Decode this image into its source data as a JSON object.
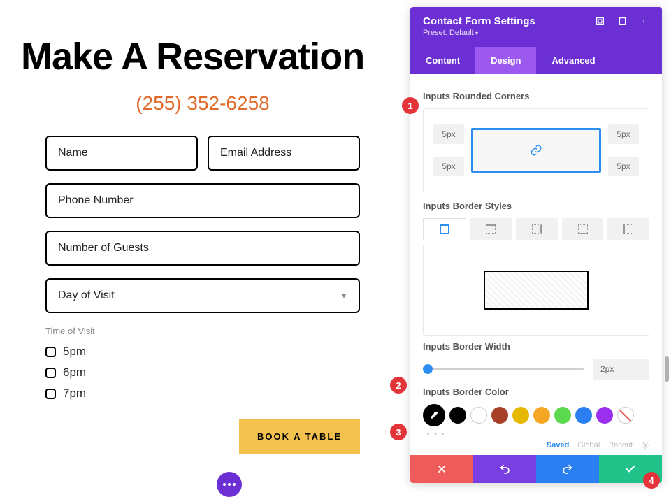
{
  "preview": {
    "title": "Make A Reservation",
    "phone": "(255) 352-6258",
    "fields": {
      "name": "Name",
      "email": "Email Address",
      "phone_number": "Phone Number",
      "guests": "Number of Guests",
      "day": "Day of Visit"
    },
    "time_label": "Time of Visit",
    "times": [
      "5pm",
      "6pm",
      "7pm"
    ],
    "submit": "BOOK A TABLE"
  },
  "panel": {
    "title": "Contact Form Settings",
    "preset": "Preset: Default",
    "tabs": {
      "content": "Content",
      "design": "Design",
      "advanced": "Advanced"
    },
    "rounded": {
      "label": "Inputs Rounded Corners",
      "tl": "5px",
      "tr": "5px",
      "bl": "5px",
      "br": "5px"
    },
    "border_styles": {
      "label": "Inputs Border Styles"
    },
    "border_width": {
      "label": "Inputs Border Width",
      "value": "2px"
    },
    "border_color": {
      "label": "Inputs Border Color",
      "swatches": [
        "#000000",
        "#000000",
        "#ffffff",
        "#a64027",
        "#e6b800",
        "#f5a623",
        "#5bd94d",
        "#2b7ff0",
        "#9a2ff0"
      ]
    },
    "color_tabs": {
      "saved": "Saved",
      "global": "Global",
      "recent": "Recent"
    }
  },
  "callouts": {
    "one": "1",
    "two": "2",
    "three": "3",
    "four": "4"
  }
}
